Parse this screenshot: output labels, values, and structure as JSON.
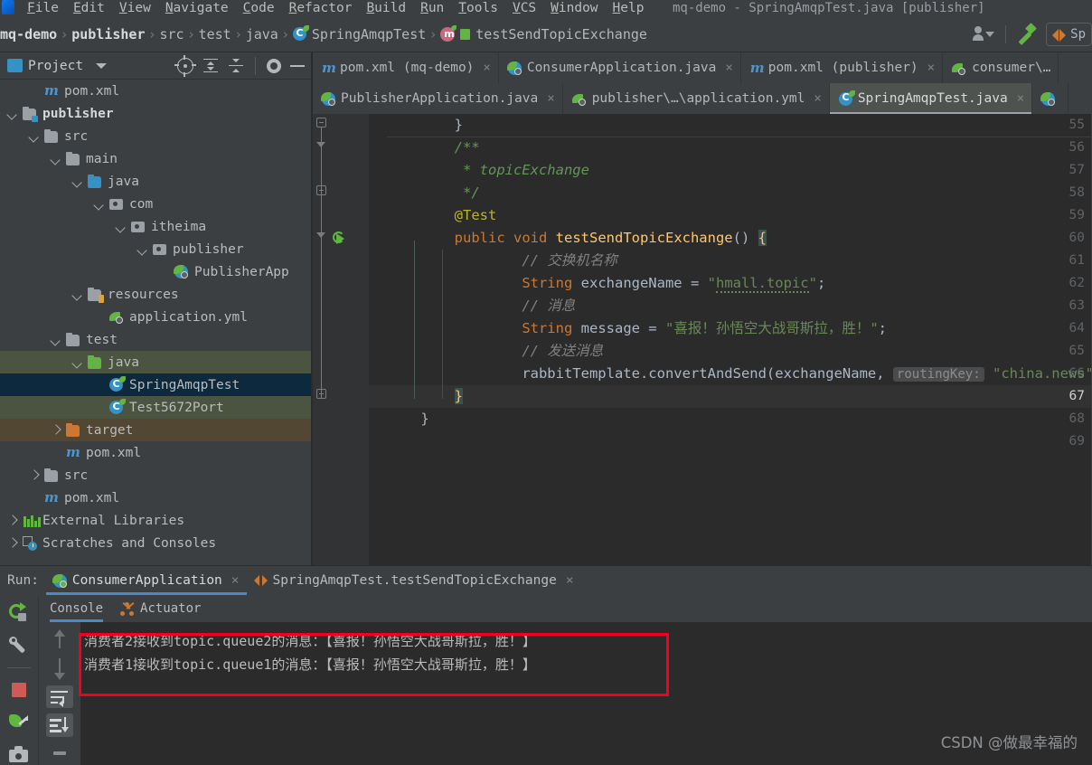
{
  "window": {
    "title": "mq-demo - SpringAmqpTest.java [publisher]",
    "menu": [
      "File",
      "Edit",
      "View",
      "Navigate",
      "Code",
      "Refactor",
      "Build",
      "Run",
      "Tools",
      "VCS",
      "Window",
      "Help"
    ]
  },
  "navbar": {
    "crumbs": [
      "mq-demo",
      "publisher",
      "src",
      "test",
      "java",
      "SpringAmqpTest",
      "testSendTopicExchange"
    ],
    "separator": "›",
    "run_config_label": "Sp",
    "icons": [
      "user-avatar-icon",
      "chevron-down-icon",
      "hammer-build-icon",
      "run-config-icon"
    ]
  },
  "project_panel": {
    "title": "Project",
    "toolbar_icons": [
      "locate-target-icon",
      "expand-all-icon",
      "collapse-all-icon",
      "settings-gear-icon",
      "minimize-icon"
    ],
    "tree": [
      {
        "label": "pom.xml",
        "depth": 2,
        "icon": "maven-icon",
        "arrow": "none",
        "state": "none",
        "bold": false,
        "clipped": true
      },
      {
        "label": "publisher",
        "depth": 1,
        "icon": "module-folder-icon",
        "arrow": "down",
        "state": "none",
        "bold": true
      },
      {
        "label": "src",
        "depth": 2,
        "icon": "folder-icon",
        "arrow": "down",
        "state": "none",
        "bold": false
      },
      {
        "label": "main",
        "depth": 3,
        "icon": "folder-icon",
        "arrow": "down",
        "state": "none",
        "bold": false
      },
      {
        "label": "java",
        "depth": 4,
        "icon": "source-folder-icon",
        "arrow": "down",
        "state": "none",
        "bold": false
      },
      {
        "label": "com",
        "depth": 5,
        "icon": "package-icon",
        "arrow": "down",
        "state": "none",
        "bold": false
      },
      {
        "label": "itheima",
        "depth": 6,
        "icon": "package-icon",
        "arrow": "down",
        "state": "none",
        "bold": false
      },
      {
        "label": "publisher",
        "depth": 7,
        "icon": "package-icon",
        "arrow": "down",
        "state": "none",
        "bold": false
      },
      {
        "label": "PublisherApp",
        "depth": 8,
        "icon": "spring-class-icon",
        "arrow": "none",
        "state": "none",
        "bold": false
      },
      {
        "label": "resources",
        "depth": 4,
        "icon": "resources-folder-icon",
        "arrow": "down",
        "state": "none",
        "bold": false
      },
      {
        "label": "application.yml",
        "depth": 5,
        "icon": "yml-spring-icon",
        "arrow": "none",
        "state": "none",
        "bold": false
      },
      {
        "label": "test",
        "depth": 3,
        "icon": "folder-icon",
        "arrow": "down",
        "state": "none",
        "bold": false
      },
      {
        "label": "java",
        "depth": 4,
        "icon": "test-source-folder-icon",
        "arrow": "down",
        "state": "green",
        "bold": false
      },
      {
        "label": "SpringAmqpTest",
        "depth": 5,
        "icon": "class-icon",
        "arrow": "none",
        "state": "blue",
        "bold": false
      },
      {
        "label": "Test5672Port",
        "depth": 5,
        "icon": "class-icon",
        "arrow": "none",
        "state": "green",
        "bold": false
      },
      {
        "label": "target",
        "depth": 3,
        "icon": "excluded-folder-icon",
        "arrow": "right",
        "state": "brown",
        "bold": false
      },
      {
        "label": "pom.xml",
        "depth": 3,
        "icon": "maven-icon",
        "arrow": "none",
        "state": "none",
        "bold": false
      },
      {
        "label": "src",
        "depth": 2,
        "icon": "folder-icon",
        "arrow": "right",
        "state": "none",
        "bold": false
      },
      {
        "label": "pom.xml",
        "depth": 2,
        "icon": "maven-icon",
        "arrow": "none",
        "state": "none",
        "bold": false
      },
      {
        "label": "External Libraries",
        "depth": 1,
        "icon": "libraries-icon",
        "arrow": "right",
        "state": "none",
        "bold": false
      },
      {
        "label": "Scratches and Consoles",
        "depth": 1,
        "icon": "scratches-icon",
        "arrow": "right",
        "state": "none",
        "bold": false
      }
    ]
  },
  "editor_tabs": {
    "row1": [
      {
        "label": "pom.xml (mq-demo)",
        "icon": "maven-icon",
        "active": false,
        "close": "×"
      },
      {
        "label": "ConsumerApplication.java",
        "icon": "spring-class-icon",
        "active": false,
        "close": "×"
      },
      {
        "label": "pom.xml (publisher)",
        "icon": "maven-icon",
        "active": false,
        "close": "×"
      },
      {
        "label": "consumer\\…",
        "icon": "yml-spring-icon",
        "active": false,
        "close": ""
      }
    ],
    "row2": [
      {
        "label": "PublisherApplication.java",
        "icon": "spring-class-icon",
        "active": false,
        "close": "×"
      },
      {
        "label": "publisher\\…\\application.yml",
        "icon": "yml-spring-icon",
        "active": false,
        "close": "×"
      },
      {
        "label": "SpringAmqpTest.java",
        "icon": "class-icon",
        "active": true,
        "close": "×"
      },
      {
        "label": "",
        "icon": "spring-class-icon",
        "active": false,
        "close": ""
      }
    ]
  },
  "editor": {
    "first_line_number": 55,
    "current_line": 67,
    "lines": [
      {
        "n": 55,
        "indent": 2,
        "html": "<span class='pr'>}</span>"
      },
      {
        "n": 56,
        "indent": 2,
        "html": "<span class='jdoc'>/**</span>"
      },
      {
        "n": 57,
        "indent": 2,
        "html": "<span class='jdoc'> * topicExchange</span>"
      },
      {
        "n": 58,
        "indent": 2,
        "html": "<span class='jdoc'> */</span>"
      },
      {
        "n": 59,
        "indent": 2,
        "html": "<span class='ann'>@Test</span>"
      },
      {
        "n": 60,
        "indent": 2,
        "html": "<span class='k'>public</span> <span class='k'>void</span> <span class='mname'>testSendTopicExchange</span><span class='pr'>()</span> <span class='brace-hl'>{</span>"
      },
      {
        "n": 61,
        "indent": 4,
        "html": "<span class='cmt'>// 交换机名称</span>"
      },
      {
        "n": 62,
        "indent": 4,
        "html": "<span class='k'>String</span> <span class='pr'>exchangeName = </span><span class='str'>\"</span><span class='str sqg'>hmall.topic</span><span class='str'>\"</span><span class='pr'>;</span>"
      },
      {
        "n": 63,
        "indent": 4,
        "html": "<span class='cmt'>// 消息</span>"
      },
      {
        "n": 64,
        "indent": 4,
        "html": "<span class='k'>String</span> <span class='pr'>message = </span><span class='str'>\"喜报！孙悟空大战哥斯拉，胜！\"</span><span class='pr'>;</span>"
      },
      {
        "n": 65,
        "indent": 4,
        "html": "<span class='cmt'>// 发送消息</span>"
      },
      {
        "n": 66,
        "indent": 4,
        "html": "<span class='pr'>rabbitTemplate.convertAndSend(exchangeName, </span><span class='hint'>routingKey:</span> <span class='str'>\"china.news\"</span><span class='pr'>, message);</span>"
      },
      {
        "n": 67,
        "indent": 2,
        "html": "<span class='brace-hl'>}</span>"
      },
      {
        "n": 68,
        "indent": 1,
        "html": "<span class='pr'>}</span>"
      },
      {
        "n": 69,
        "indent": 0,
        "html": ""
      }
    ]
  },
  "run_panel": {
    "label": "Run:",
    "tabs": [
      {
        "label": "ConsumerApplication",
        "icon": "spring-run-icon",
        "active": true,
        "close": "×"
      },
      {
        "label": "SpringAmqpTest.testSendTopicExchange",
        "icon": "junit-icon",
        "active": false,
        "close": "×"
      }
    ],
    "toolbar_icons": [
      "rerun-icon",
      "wrench-settings-icon",
      "stop-icon",
      "thread-dump-icon",
      "screenshot-camera-icon"
    ],
    "console_tabs": [
      {
        "label": "Console",
        "icon": "",
        "active": true
      },
      {
        "label": "Actuator",
        "icon": "actuator-icon",
        "active": false
      }
    ],
    "side_buttons": [
      "scroll-up-icon",
      "scroll-down-icon",
      "soft-wrap-icon",
      "scroll-to-end-icon",
      "print-icon"
    ],
    "console_output": [
      "消费者2接收到topic.queue2的消息：【喜报！孙悟空大战哥斯拉，胜！】",
      "消费者1接收到topic.queue1的消息：【喜报！孙悟空大战哥斯拉，胜！】"
    ],
    "highlight_box_color": "#f4001e"
  },
  "watermark": "CSDN @做最幸福的",
  "colors": {
    "bg": "#3c3f41",
    "editor_bg": "#2b2b2b",
    "accent_blue": "#4a88c7",
    "selection_blue": "#0d293e",
    "selection_green": "#4a5440",
    "selection_brown": "#514733",
    "keyword_orange": "#cc7832",
    "string_green": "#6a8759",
    "method_yellow": "#ffc66d",
    "comment_gray": "#808080",
    "javadoc_green": "#629755"
  }
}
